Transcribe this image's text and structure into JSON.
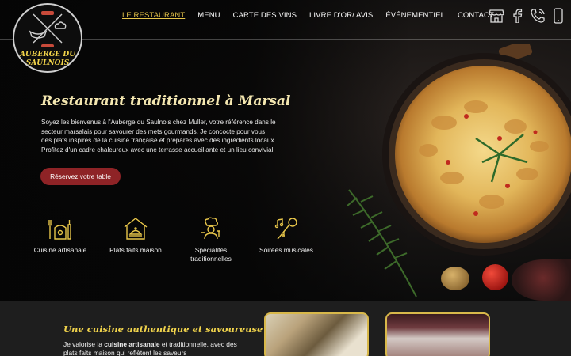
{
  "logo": {
    "line1": "AUBERGE DU",
    "line2": "SAULNOIS"
  },
  "nav": {
    "items": [
      {
        "label": "LE RESTAURANT",
        "active": true
      },
      {
        "label": "MENU"
      },
      {
        "label": "CARTE DES VINS"
      },
      {
        "label": "LIVRE D'OR/ AVIS"
      },
      {
        "label": "ÉVÉNEMENTIEL"
      },
      {
        "label": "CONTACT"
      }
    ]
  },
  "header_icons": [
    "store-icon",
    "facebook-icon",
    "phone-icon",
    "mobile-icon"
  ],
  "hero": {
    "title": "Restaurant traditionnel à Marsal",
    "text": "Soyez les bienvenus à l'Auberge du Saulnois chez Muller, votre référence dans le secteur marsalais pour savourer des mets gourmands. Je concocte pour vous des plats inspirés de la cuisine française et préparés avec des ingrédients locaux. Profitez d'un cadre chaleureux avec une terrasse accueillante et un lieu convivial.",
    "cta": "Réservez votre table"
  },
  "features": [
    {
      "icon": "kitchen-tools-icon",
      "label": "Cuisine artisanale"
    },
    {
      "icon": "house-dish-icon",
      "label": "Plats faits maison"
    },
    {
      "icon": "chef-icon",
      "label": "Spécialités traditionnelles"
    },
    {
      "icon": "microphone-music-icon",
      "label": "Soirées musicales"
    }
  ],
  "section2": {
    "title": "Une cuisine authentique et savoureuse",
    "text_prefix": "Je valorise la ",
    "text_bold": "cuisine artisanale",
    "text_suffix": " et traditionnelle, avec des plats faits maison qui reflètent les saveurs"
  },
  "colors": {
    "accent": "#e8c64a",
    "cta": "#8e2326",
    "title": "#f4e7b0"
  }
}
